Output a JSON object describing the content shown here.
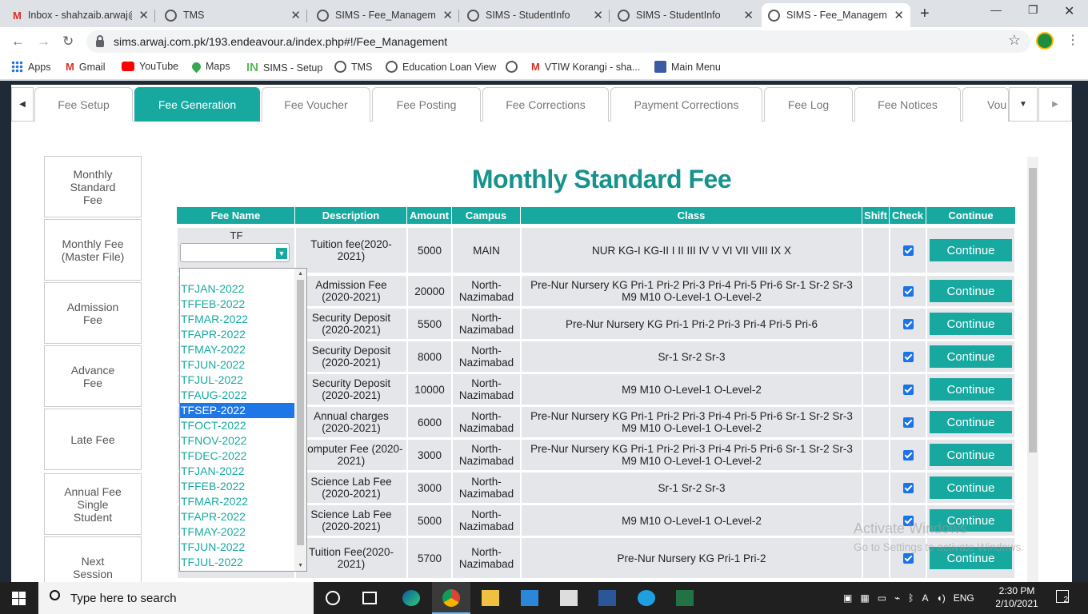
{
  "browser": {
    "tabs": [
      {
        "title": "Inbox - shahzaib.arwaj@",
        "icon": "gmail-icon"
      },
      {
        "title": "TMS",
        "icon": "globe-icon"
      },
      {
        "title": "SIMS - Fee_Manageme",
        "icon": "globe-icon"
      },
      {
        "title": "SIMS - StudentInfo",
        "icon": "globe-icon"
      },
      {
        "title": "SIMS - StudentInfo",
        "icon": "globe-icon"
      },
      {
        "title": "SIMS - Fee_Manageme",
        "icon": "globe-icon",
        "active": true
      }
    ],
    "url": "sims.arwaj.com.pk/193.endeavour.a/index.php#!/Fee_Management",
    "bookmarks": [
      "Apps",
      "Gmail",
      "YouTube",
      "Maps",
      "SIMS - Setup",
      "TMS",
      "Education Loan View",
      "",
      "VTIW Korangi - sha...",
      "Main Menu"
    ]
  },
  "module_tabs": [
    "Fee Setup",
    "Fee Generation",
    "Fee Voucher",
    "Fee Posting",
    "Fee Corrections",
    "Payment Corrections",
    "Fee Log",
    "Fee Notices",
    "Vou"
  ],
  "active_module_tab": "Fee Generation",
  "sidebar": [
    "Monthly Standard Fee",
    "Monthly Fee (Master File)",
    "Admission Fee",
    "Advance Fee",
    "Late Fee",
    "Annual Fee Single Student",
    "Next Session"
  ],
  "page_title": "Monthly Standard Fee",
  "table": {
    "headers": [
      "Fee Name",
      "Description",
      "Amount",
      "Campus",
      "Class",
      "Shift",
      "Check",
      "Continue"
    ],
    "fee_name_label": "TF",
    "continue_label": "Continue",
    "rows": [
      {
        "description": "Tuition fee(2020-2021)",
        "amount": "5000",
        "campus": "MAIN",
        "class": "NUR KG-I KG-II I II III IV V VI VII VIII IX X",
        "checked": true
      },
      {
        "description": "Admission Fee (2020-2021)",
        "amount": "20000",
        "campus": "North-Nazimabad",
        "class": "Pre-Nur Nursery KG Pri-1 Pri-2 Pri-3 Pri-4 Pri-5 Pri-6 Sr-1 Sr-2 Sr-3 M9 M10 O-Level-1 O-Level-2",
        "checked": true
      },
      {
        "description": "Security Deposit (2020-2021)",
        "amount": "5500",
        "campus": "North-Nazimabad",
        "class": "Pre-Nur Nursery KG Pri-1 Pri-2 Pri-3 Pri-4 Pri-5 Pri-6",
        "checked": true
      },
      {
        "description": "Security Deposit (2020-2021)",
        "amount": "8000",
        "campus": "North-Nazimabad",
        "class": "Sr-1 Sr-2 Sr-3",
        "checked": true
      },
      {
        "description": "Security Deposit (2020-2021)",
        "amount": "10000",
        "campus": "North-Nazimabad",
        "class": "M9 M10 O-Level-1 O-Level-2",
        "checked": true
      },
      {
        "description": "Annual charges (2020-2021)",
        "amount": "6000",
        "campus": "North-Nazimabad",
        "class": "Pre-Nur Nursery KG Pri-1 Pri-2 Pri-3 Pri-4 Pri-5 Pri-6 Sr-1 Sr-2 Sr-3 M9 M10 O-Level-1 O-Level-2",
        "checked": true
      },
      {
        "description": "Computer Fee (2020-2021)",
        "amount": "3000",
        "campus": "North-Nazimabad",
        "class": "Pre-Nur Nursery KG Pri-1 Pri-2 Pri-3 Pri-4 Pri-5 Pri-6 Sr-1 Sr-2 Sr-3 M9 M10 O-Level-1 O-Level-2",
        "checked": true
      },
      {
        "description": "Science Lab Fee (2020-2021)",
        "amount": "3000",
        "campus": "North-Nazimabad",
        "class": "Sr-1 Sr-2 Sr-3",
        "checked": true
      },
      {
        "description": "Science Lab Fee (2020-2021)",
        "amount": "5000",
        "campus": "North-Nazimabad",
        "class": "M9 M10 O-Level-1 O-Level-2",
        "checked": true
      },
      {
        "description": "Tuition Fee(2020-2021)",
        "amount": "5700",
        "campus": "North-Nazimabad",
        "class": "Pre-Nur Nursery KG Pri-1 Pri-2",
        "checked": true
      }
    ]
  },
  "dropdown": {
    "options": [
      "TFJAN-2022",
      "TFFEB-2022",
      "TFMAR-2022",
      "TFAPR-2022",
      "TFMAY-2022",
      "TFJUN-2022",
      "TFJUL-2022",
      "TFAUG-2022",
      "TFSEP-2022",
      "TFOCT-2022",
      "TFNOV-2022",
      "TFDEC-2022",
      "TFJAN-2022",
      "TFFEB-2022",
      "TFMAR-2022",
      "TFAPR-2022",
      "TFMAY-2022",
      "TFJUN-2022",
      "TFJUL-2022"
    ],
    "highlighted": "TFSEP-2022"
  },
  "watermark": {
    "line1": "Activate Windows",
    "line2": "Go to Settings to activate Windows."
  },
  "taskbar": {
    "search_placeholder": "Type here to search",
    "time": "2:30 PM",
    "date": "2/10/2021",
    "notifications": "2"
  },
  "colors": {
    "accent": "#17a9a0",
    "title": "#17928c",
    "highlight": "#1e77e6"
  }
}
